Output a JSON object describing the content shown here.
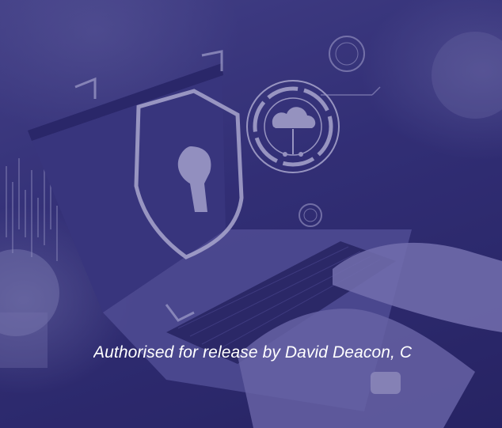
{
  "caption": {
    "text": "Authorised for release by David Deacon, C"
  },
  "icons": [
    "shield-keyhole-icon",
    "cloud-icon"
  ],
  "colors": {
    "overlay": "#34317a",
    "caption_text": "#ffffff"
  }
}
